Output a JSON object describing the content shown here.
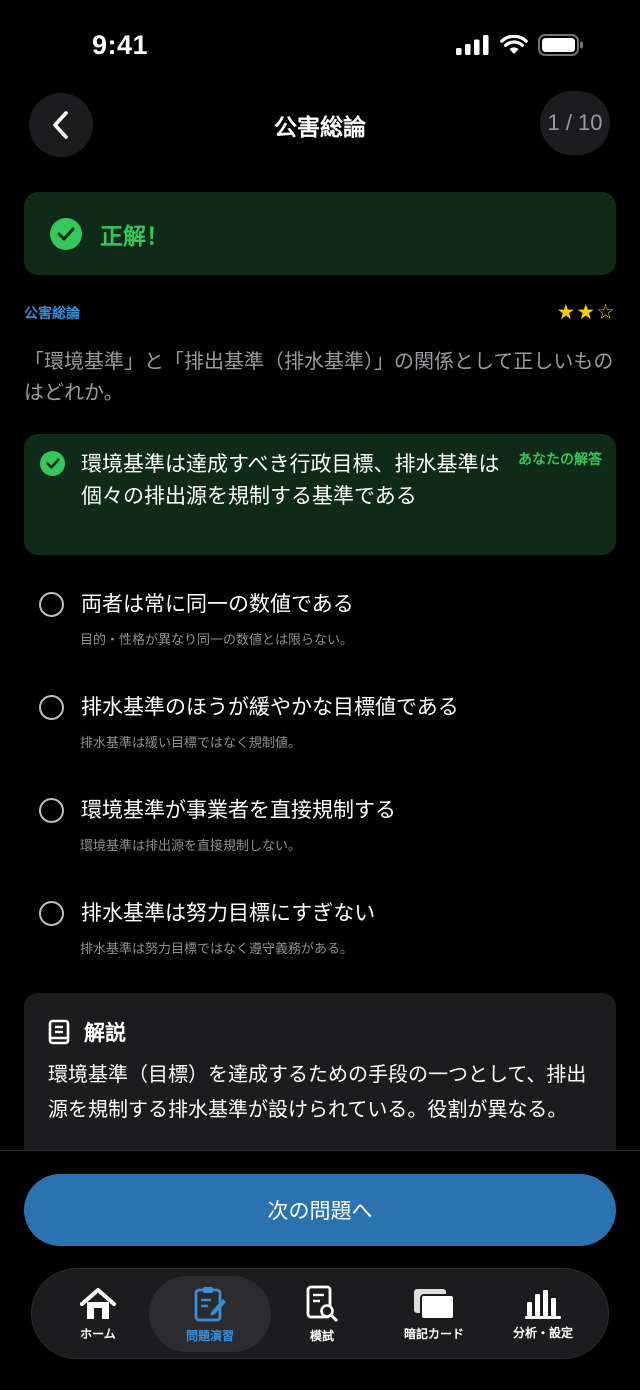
{
  "status": {
    "time": "9:41"
  },
  "nav": {
    "title": "公害総論",
    "progress": "1 / 10"
  },
  "result": {
    "label": "正解！"
  },
  "meta": {
    "category": "公害総論",
    "difficulty": 2,
    "difficulty_max": 3
  },
  "question": "「環境基準」と「排出基準（排水基準）」の関係として正しいものはどれか。",
  "choices": {
    "correct": {
      "text": "環境基準は達成すべき行政目標、排水基準は個々の排出源を規制する基準である",
      "badge": "あなたの解答"
    },
    "items": [
      {
        "text": "両者は常に同一の数値である",
        "note": "目的・性格が異なり同一の数値とは限らない。"
      },
      {
        "text": "排水基準のほうが緩やかな目標値である",
        "note": "排水基準は緩い目標ではなく規制値。"
      },
      {
        "text": "環境基準が事業者を直接規制する",
        "note": "環境基準は排出源を直接規制しない。"
      },
      {
        "text": "排水基準は努力目標にすぎない",
        "note": "排水基準は努力目標ではなく遵守義務がある。"
      }
    ]
  },
  "explanation": {
    "title": "解説",
    "body": "環境基準（目標）を達成するための手段の一つとして、排出源を規制する排水基準が設けられている。役割が異なる。"
  },
  "next_button": "次の問題へ",
  "tabs": [
    {
      "label": "ホーム",
      "icon": "home-icon"
    },
    {
      "label": "問題演習",
      "icon": "clipboard-edit-icon",
      "active": true
    },
    {
      "label": "模試",
      "icon": "document-search-icon"
    },
    {
      "label": "暗記カード",
      "icon": "cards-icon"
    },
    {
      "label": "分析・設定",
      "icon": "bar-chart-icon"
    }
  ],
  "colors": {
    "accent_green": "#34c759",
    "accent_blue": "#2a73b0",
    "tab_active": "#3a8fd8",
    "star": "#ffcc00"
  }
}
